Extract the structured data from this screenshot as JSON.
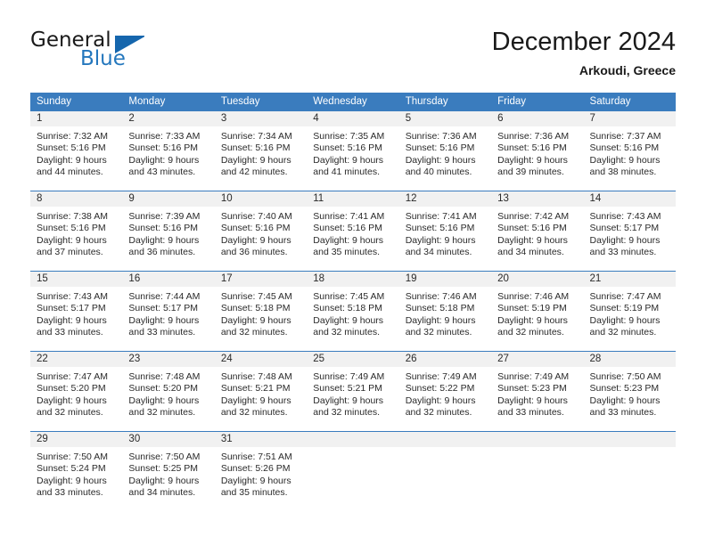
{
  "brand": {
    "word_one": "General",
    "word_two": "Blue",
    "triangle_color": "#1566ad",
    "blue_text_color": "#2477bd"
  },
  "header": {
    "title": "December 2024",
    "subtitle": "Arkoudi, Greece"
  },
  "calendar": {
    "header_bg": "#3a7cbe",
    "header_text_color": "#ffffff",
    "daynum_bg": "#f1f1f1",
    "weekdays": [
      "Sunday",
      "Monday",
      "Tuesday",
      "Wednesday",
      "Thursday",
      "Friday",
      "Saturday"
    ],
    "weeks": [
      [
        {
          "day": "1",
          "sunrise": "Sunrise: 7:32 AM",
          "sunset": "Sunset: 5:16 PM",
          "daylight_line1": "Daylight: 9 hours",
          "daylight_line2": "and 44 minutes."
        },
        {
          "day": "2",
          "sunrise": "Sunrise: 7:33 AM",
          "sunset": "Sunset: 5:16 PM",
          "daylight_line1": "Daylight: 9 hours",
          "daylight_line2": "and 43 minutes."
        },
        {
          "day": "3",
          "sunrise": "Sunrise: 7:34 AM",
          "sunset": "Sunset: 5:16 PM",
          "daylight_line1": "Daylight: 9 hours",
          "daylight_line2": "and 42 minutes."
        },
        {
          "day": "4",
          "sunrise": "Sunrise: 7:35 AM",
          "sunset": "Sunset: 5:16 PM",
          "daylight_line1": "Daylight: 9 hours",
          "daylight_line2": "and 41 minutes."
        },
        {
          "day": "5",
          "sunrise": "Sunrise: 7:36 AM",
          "sunset": "Sunset: 5:16 PM",
          "daylight_line1": "Daylight: 9 hours",
          "daylight_line2": "and 40 minutes."
        },
        {
          "day": "6",
          "sunrise": "Sunrise: 7:36 AM",
          "sunset": "Sunset: 5:16 PM",
          "daylight_line1": "Daylight: 9 hours",
          "daylight_line2": "and 39 minutes."
        },
        {
          "day": "7",
          "sunrise": "Sunrise: 7:37 AM",
          "sunset": "Sunset: 5:16 PM",
          "daylight_line1": "Daylight: 9 hours",
          "daylight_line2": "and 38 minutes."
        }
      ],
      [
        {
          "day": "8",
          "sunrise": "Sunrise: 7:38 AM",
          "sunset": "Sunset: 5:16 PM",
          "daylight_line1": "Daylight: 9 hours",
          "daylight_line2": "and 37 minutes."
        },
        {
          "day": "9",
          "sunrise": "Sunrise: 7:39 AM",
          "sunset": "Sunset: 5:16 PM",
          "daylight_line1": "Daylight: 9 hours",
          "daylight_line2": "and 36 minutes."
        },
        {
          "day": "10",
          "sunrise": "Sunrise: 7:40 AM",
          "sunset": "Sunset: 5:16 PM",
          "daylight_line1": "Daylight: 9 hours",
          "daylight_line2": "and 36 minutes."
        },
        {
          "day": "11",
          "sunrise": "Sunrise: 7:41 AM",
          "sunset": "Sunset: 5:16 PM",
          "daylight_line1": "Daylight: 9 hours",
          "daylight_line2": "and 35 minutes."
        },
        {
          "day": "12",
          "sunrise": "Sunrise: 7:41 AM",
          "sunset": "Sunset: 5:16 PM",
          "daylight_line1": "Daylight: 9 hours",
          "daylight_line2": "and 34 minutes."
        },
        {
          "day": "13",
          "sunrise": "Sunrise: 7:42 AM",
          "sunset": "Sunset: 5:16 PM",
          "daylight_line1": "Daylight: 9 hours",
          "daylight_line2": "and 34 minutes."
        },
        {
          "day": "14",
          "sunrise": "Sunrise: 7:43 AM",
          "sunset": "Sunset: 5:17 PM",
          "daylight_line1": "Daylight: 9 hours",
          "daylight_line2": "and 33 minutes."
        }
      ],
      [
        {
          "day": "15",
          "sunrise": "Sunrise: 7:43 AM",
          "sunset": "Sunset: 5:17 PM",
          "daylight_line1": "Daylight: 9 hours",
          "daylight_line2": "and 33 minutes."
        },
        {
          "day": "16",
          "sunrise": "Sunrise: 7:44 AM",
          "sunset": "Sunset: 5:17 PM",
          "daylight_line1": "Daylight: 9 hours",
          "daylight_line2": "and 33 minutes."
        },
        {
          "day": "17",
          "sunrise": "Sunrise: 7:45 AM",
          "sunset": "Sunset: 5:18 PM",
          "daylight_line1": "Daylight: 9 hours",
          "daylight_line2": "and 32 minutes."
        },
        {
          "day": "18",
          "sunrise": "Sunrise: 7:45 AM",
          "sunset": "Sunset: 5:18 PM",
          "daylight_line1": "Daylight: 9 hours",
          "daylight_line2": "and 32 minutes."
        },
        {
          "day": "19",
          "sunrise": "Sunrise: 7:46 AM",
          "sunset": "Sunset: 5:18 PM",
          "daylight_line1": "Daylight: 9 hours",
          "daylight_line2": "and 32 minutes."
        },
        {
          "day": "20",
          "sunrise": "Sunrise: 7:46 AM",
          "sunset": "Sunset: 5:19 PM",
          "daylight_line1": "Daylight: 9 hours",
          "daylight_line2": "and 32 minutes."
        },
        {
          "day": "21",
          "sunrise": "Sunrise: 7:47 AM",
          "sunset": "Sunset: 5:19 PM",
          "daylight_line1": "Daylight: 9 hours",
          "daylight_line2": "and 32 minutes."
        }
      ],
      [
        {
          "day": "22",
          "sunrise": "Sunrise: 7:47 AM",
          "sunset": "Sunset: 5:20 PM",
          "daylight_line1": "Daylight: 9 hours",
          "daylight_line2": "and 32 minutes."
        },
        {
          "day": "23",
          "sunrise": "Sunrise: 7:48 AM",
          "sunset": "Sunset: 5:20 PM",
          "daylight_line1": "Daylight: 9 hours",
          "daylight_line2": "and 32 minutes."
        },
        {
          "day": "24",
          "sunrise": "Sunrise: 7:48 AM",
          "sunset": "Sunset: 5:21 PM",
          "daylight_line1": "Daylight: 9 hours",
          "daylight_line2": "and 32 minutes."
        },
        {
          "day": "25",
          "sunrise": "Sunrise: 7:49 AM",
          "sunset": "Sunset: 5:21 PM",
          "daylight_line1": "Daylight: 9 hours",
          "daylight_line2": "and 32 minutes."
        },
        {
          "day": "26",
          "sunrise": "Sunrise: 7:49 AM",
          "sunset": "Sunset: 5:22 PM",
          "daylight_line1": "Daylight: 9 hours",
          "daylight_line2": "and 32 minutes."
        },
        {
          "day": "27",
          "sunrise": "Sunrise: 7:49 AM",
          "sunset": "Sunset: 5:23 PM",
          "daylight_line1": "Daylight: 9 hours",
          "daylight_line2": "and 33 minutes."
        },
        {
          "day": "28",
          "sunrise": "Sunrise: 7:50 AM",
          "sunset": "Sunset: 5:23 PM",
          "daylight_line1": "Daylight: 9 hours",
          "daylight_line2": "and 33 minutes."
        }
      ],
      [
        {
          "day": "29",
          "sunrise": "Sunrise: 7:50 AM",
          "sunset": "Sunset: 5:24 PM",
          "daylight_line1": "Daylight: 9 hours",
          "daylight_line2": "and 33 minutes."
        },
        {
          "day": "30",
          "sunrise": "Sunrise: 7:50 AM",
          "sunset": "Sunset: 5:25 PM",
          "daylight_line1": "Daylight: 9 hours",
          "daylight_line2": "and 34 minutes."
        },
        {
          "day": "31",
          "sunrise": "Sunrise: 7:51 AM",
          "sunset": "Sunset: 5:26 PM",
          "daylight_line1": "Daylight: 9 hours",
          "daylight_line2": "and 35 minutes."
        },
        {
          "day": "",
          "sunrise": "",
          "sunset": "",
          "daylight_line1": "",
          "daylight_line2": ""
        },
        {
          "day": "",
          "sunrise": "",
          "sunset": "",
          "daylight_line1": "",
          "daylight_line2": ""
        },
        {
          "day": "",
          "sunrise": "",
          "sunset": "",
          "daylight_line1": "",
          "daylight_line2": ""
        },
        {
          "day": "",
          "sunrise": "",
          "sunset": "",
          "daylight_line1": "",
          "daylight_line2": ""
        }
      ]
    ]
  }
}
